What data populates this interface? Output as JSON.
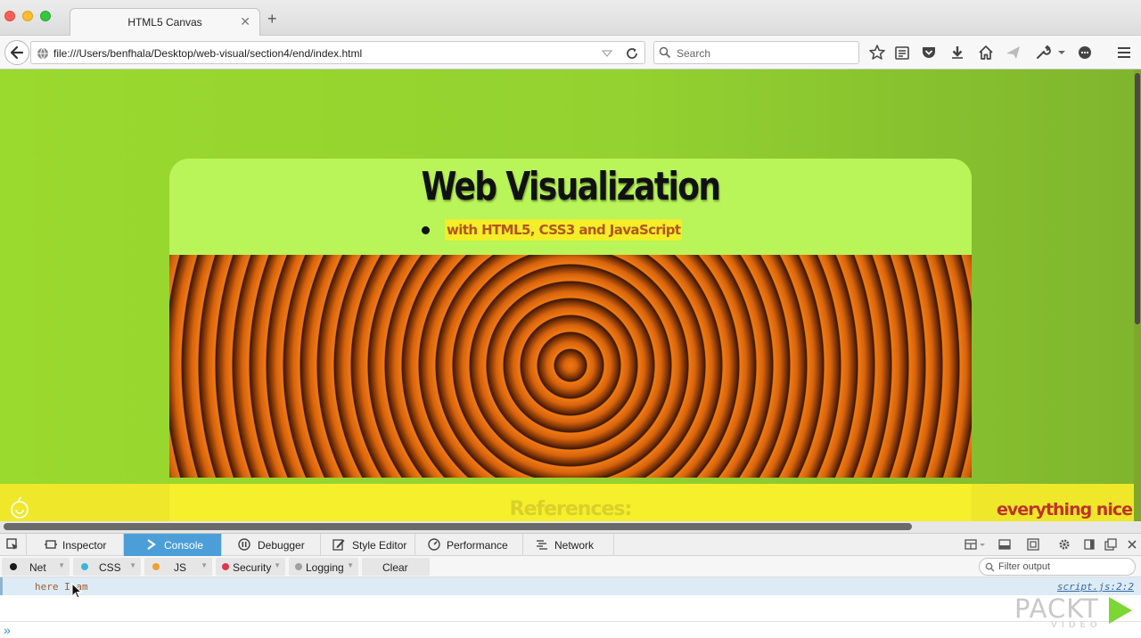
{
  "browser": {
    "tab_title": "HTML5 Canvas",
    "url": "file:///Users/benfhala/Desktop/web-visual/section4/end/index.html",
    "search_placeholder": "Search"
  },
  "page": {
    "title": "Web Visualization",
    "subtitle": "with HTML5, CSS3 and JavaScript",
    "references_heading": "References:",
    "footer_tagline": "everything nice",
    "colors": {
      "background": "#9ad92e",
      "header_card": "#b9f458",
      "subtitle_highlight": "#f2ee2a",
      "canvas_ring_orange": "#f07a14",
      "footer_band": "#f5ef2c",
      "tagline": "#c0322a"
    }
  },
  "devtools": {
    "tabs": [
      {
        "label": "Inspector",
        "icon": "inspector-icon"
      },
      {
        "label": "Console",
        "icon": "console-icon",
        "active": true
      },
      {
        "label": "Debugger",
        "icon": "debugger-icon"
      },
      {
        "label": "Style Editor",
        "icon": "style-editor-icon"
      },
      {
        "label": "Performance",
        "icon": "performance-icon"
      },
      {
        "label": "Network",
        "icon": "network-icon"
      }
    ],
    "filters": [
      {
        "label": "Net",
        "dot_color": "#1a1a1a"
      },
      {
        "label": "CSS",
        "dot_color": "#3ab5d8"
      },
      {
        "label": "JS",
        "dot_color": "#f0a030"
      },
      {
        "label": "Security",
        "dot_color": "#e0364a"
      },
      {
        "label": "Logging",
        "dot_color": "#a0a0a0"
      }
    ],
    "clear_label": "Clear",
    "filter_placeholder": "Filter output",
    "console_message": "here I am",
    "console_source": "script.js:2:2",
    "prompt_symbol": "»",
    "accent_color": "#4c9ed9"
  },
  "watermark": {
    "brand": "PACKT",
    "sub": "VIDEO"
  }
}
